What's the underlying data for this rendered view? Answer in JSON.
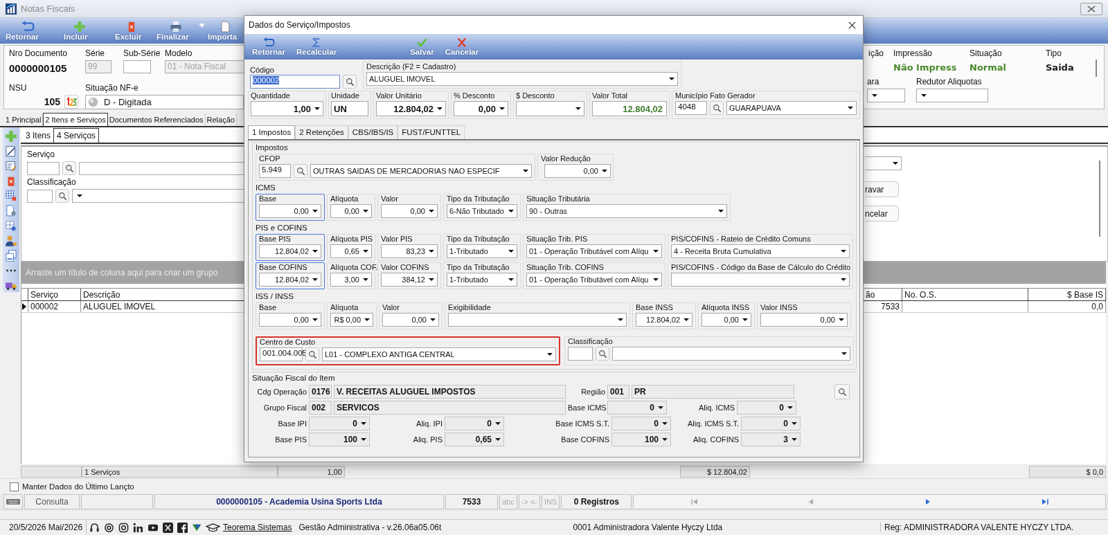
{
  "main_window": {
    "title": "Notas Fiscais",
    "toolbar": [
      {
        "label": "Retornar",
        "has_menu": false
      },
      {
        "label": "Incluir",
        "has_menu": false
      },
      {
        "label": "Excluir",
        "has_menu": false
      },
      {
        "label": "Finalizar",
        "has_menu": true
      },
      {
        "label": "Importa",
        "has_menu": false
      }
    ],
    "header": {
      "document": {
        "label": "Nro Documento",
        "value": "0000000105"
      },
      "serie": {
        "label": "Série",
        "value": "99",
        "disabled": true
      },
      "sub_serie": {
        "label": "Sub-Série",
        "disabled": false
      },
      "modelo": {
        "label": "Modelo",
        "value": "01 - Nota Fiscal",
        "disabled": true
      },
      "nsu": {
        "label": "NSU",
        "value": "105"
      },
      "situacao_nfe": {
        "label": "Situação NF-e",
        "value": "D - Digitada"
      },
      "status_columns": [
        {
          "label": "ição"
        },
        {
          "label": "Impressão",
          "value": "Não Impress",
          "color": "#4a8a2c"
        },
        {
          "label": "Situação",
          "value": "Normal",
          "color": "#4a8a2c"
        },
        {
          "label": "Tipo",
          "value": "Saida",
          "color": "#1a1a1a"
        }
      ],
      "selects": [
        {
          "label": "ara"
        },
        {
          "label": "Redutor Aliquotas"
        }
      ]
    },
    "tabs": [
      {
        "label": "1 Principal",
        "selected": false
      },
      {
        "label": "2 Itens e Serviços",
        "selected": true
      },
      {
        "label": "Documentos Referenciados",
        "selected": false
      },
      {
        "label": "Relação",
        "selected": false
      }
    ],
    "sub_tabs": [
      {
        "label": "3 Itens",
        "selected": false
      },
      {
        "label": "4 Serviços",
        "selected": true
      }
    ],
    "service_form": {
      "servico_label": "Serviço",
      "classificacao_label": "Classificação",
      "buttons": [
        "ravar",
        "ncelar"
      ]
    },
    "grid": {
      "group_hint": "Arraste um título de coluna aqui para criar um grupo",
      "columns": [
        "Serviço",
        "Descrição",
        "ão",
        "No. O.S.",
        "$ Base IS"
      ],
      "rows": [
        {
          "selected": true,
          "servico": "000002",
          "descricao": "ALUGUEL IMOVEL",
          "column_3": "7533",
          "base_is": "0,0"
        }
      ],
      "totals": {
        "count": "1 Serviços",
        "quantity": "1,00",
        "total": "$ 12.804,02",
        "base_is": "$ 0,0"
      }
    },
    "keep_data": {
      "label": "Manter Dados do Último Lançto",
      "checked": false
    },
    "status_bar": {
      "mode": "Consulta",
      "document": "0000000105 - Academia Usina Sports Ltda",
      "number": "7533",
      "indicators": [
        "abc",
        "-> <-",
        "INS"
      ],
      "records": "0 Registros"
    },
    "footer": {
      "date": "20/5/2026 Mai/2026",
      "brand": "Teorema Sistemas",
      "version": "Gestão Administrativa - v.26.06a05.06t",
      "company": "0001 Administradora Valente Hyczy Ltda",
      "registration": "Reg: ADMINISTRADORA VALENTE HYCZY LTDA."
    }
  },
  "dialog": {
    "title": "Dados do Serviço/Impostos",
    "toolbar": [
      {
        "label": "Retornar"
      },
      {
        "label": "Recalcular"
      },
      {
        "label": "Salvar"
      },
      {
        "label": "Cancelar"
      }
    ],
    "codigo": {
      "label": "Código",
      "value": "000002",
      "text_selected": true
    },
    "descricao": {
      "label": "Descrição (F2 = Cadastro)",
      "value": "ALUGUEL IMOVEL"
    },
    "amounts": [
      {
        "label": "Quantidade",
        "value": "1,00",
        "kind": "number"
      },
      {
        "label": "Unidade",
        "value": "UN",
        "kind": "text"
      },
      {
        "label": "Valor Unitário",
        "value": "12.804,02",
        "kind": "number"
      },
      {
        "label": "% Desconto",
        "value": "0,00",
        "kind": "number"
      },
      {
        "label": "$ Desconto",
        "kind": "number"
      },
      {
        "label": "Valor Total",
        "value": "12.804,02",
        "kind": "total"
      }
    ],
    "municipio": {
      "label": "Município Fato Gerador",
      "code": "4048",
      "value": "GUARAPUAVA"
    },
    "tabs": [
      {
        "label": "1 Impostos",
        "selected": true
      },
      {
        "label": "2 Retenções",
        "selected": false
      },
      {
        "label": "CBS/IBS/IS",
        "selected": false
      },
      {
        "label": "FUST/FUNTTEL",
        "selected": false
      }
    ],
    "impostos": {
      "title": "Impostos",
      "cfop": {
        "label": "CFOP",
        "code": "5.949",
        "value": "OUTRAS SAIDAS DE MERCADORIAS NAO ESPECIF"
      },
      "valor_reducao": {
        "label": "Valor Redução",
        "value": "0,00"
      },
      "sections": [
        {
          "title": "ICMS",
          "rows": [
            [
              {
                "label": "Base",
                "value": "0,00",
                "kind": "number",
                "focused": true
              },
              {
                "label": "Alíquota",
                "value": "0,00",
                "kind": "number",
                "focused": false
              },
              {
                "label": "Valor",
                "value": "0,00",
                "kind": "number",
                "focused": false
              },
              {
                "label": "Tipo da Tributação",
                "value": "6-Não Tributado",
                "kind": "select",
                "focused": false
              },
              {
                "label": "Situação Tributária",
                "value": "90 - Outras",
                "kind": "select",
                "focused": false
              }
            ]
          ]
        },
        {
          "title": "PIS e COFINS",
          "rows": [
            [
              {
                "label": "Base PIS",
                "value": "12.804,02",
                "kind": "number",
                "focused": true
              },
              {
                "label": "Alíquota PIS",
                "value": "0,65",
                "kind": "number",
                "focused": false
              },
              {
                "label": "Valor PIS",
                "value": "83,23",
                "kind": "number",
                "focused": false
              },
              {
                "label": "Tipo da Tributação",
                "value": "1-Tributado",
                "kind": "select",
                "focused": false
              },
              {
                "label": "Situação Trib. PIS",
                "value": "01 - Operação Tributável com Alíqu",
                "kind": "select",
                "focused": false
              },
              {
                "label": "PIS/COFINS - Rateio de Crédito Comuns",
                "value": "4 - Receita Bruta Cumulativa",
                "kind": "select",
                "focused": false
              }
            ],
            [
              {
                "label": "Base COFINS",
                "value": "12.804,02",
                "kind": "number",
                "focused": true
              },
              {
                "label": "Alíquota COF.",
                "value": "3,00",
                "kind": "number",
                "focused": false
              },
              {
                "label": "Valor COFINS",
                "value": "384,12",
                "kind": "number",
                "focused": false
              },
              {
                "label": "Tipo da Tributação",
                "value": "1-Tributado",
                "kind": "select",
                "focused": false
              },
              {
                "label": "Situação Trib. COFINS",
                "value": "01 - Operação Tributável com Alíqu",
                "kind": "select",
                "focused": false
              },
              {
                "label": "PIS/COFINS - Código da Base de Cálculo do Crédito",
                "kind": "select",
                "focused": false
              }
            ]
          ]
        },
        {
          "title": "ISS / INSS",
          "rows": [
            [
              {
                "label": "Base",
                "value": "0,00",
                "kind": "number",
                "focused": false
              },
              {
                "label": "Alíquota",
                "value": "R$ 0,00",
                "kind": "number",
                "focused": false
              },
              {
                "label": "Valor",
                "value": "0,00",
                "kind": "number",
                "focused": false
              },
              {
                "label": "Exigibilidade",
                "kind": "select",
                "focused": false
              },
              {
                "label": "Base INSS",
                "value": "12.804,02",
                "kind": "number",
                "focused": false
              },
              {
                "label": "Alíquota INSS",
                "value": "0,00",
                "kind": "number",
                "focused": false
              },
              {
                "label": "Valor INSS",
                "value": "0,00",
                "kind": "number",
                "focused": false
              }
            ]
          ]
        }
      ],
      "centro_custo": {
        "label": "Centro de Custo",
        "code": "001.004.005",
        "value": "L01 - COMPLEXO ANTIGA CENTRAL",
        "highlighted": true
      },
      "classificacao": {
        "label": "Classificação",
        "highlighted": false
      }
    },
    "situacao_fiscal": {
      "title": "Situação Fiscal do Item",
      "fields": [
        {
          "label": "Cdg Operação",
          "code": "0176",
          "value": "V. RECEITAS ALUGUEL IMPOSTOS",
          "kind": "coded"
        },
        {
          "label": "Região",
          "code": "001",
          "value": "PR",
          "kind": "coded"
        },
        {
          "label": "Grupo Fiscal",
          "code": "002",
          "value": "SERVICOS",
          "kind": "coded"
        },
        {
          "label": "Base ICMS",
          "value": "0",
          "kind": "number"
        },
        {
          "label": "Aliq. ICMS",
          "value": "0",
          "kind": "number"
        },
        {
          "label": "Base IPI",
          "value": "0",
          "kind": "number"
        },
        {
          "label": "Aliq. IPI",
          "value": "0",
          "kind": "number"
        },
        {
          "label": "Base ICMS S.T.",
          "value": "0",
          "kind": "number"
        },
        {
          "label": "Aliq. ICMS S.T.",
          "value": "0",
          "kind": "number"
        },
        {
          "label": "Base PIS",
          "value": "100",
          "kind": "number"
        },
        {
          "label": "Aliq. PIS",
          "value": "0,65",
          "kind": "number"
        },
        {
          "label": "Base COFINS",
          "value": "100",
          "kind": "number"
        },
        {
          "label": "Aliq. COFINS",
          "value": "3",
          "kind": "number"
        }
      ]
    }
  }
}
